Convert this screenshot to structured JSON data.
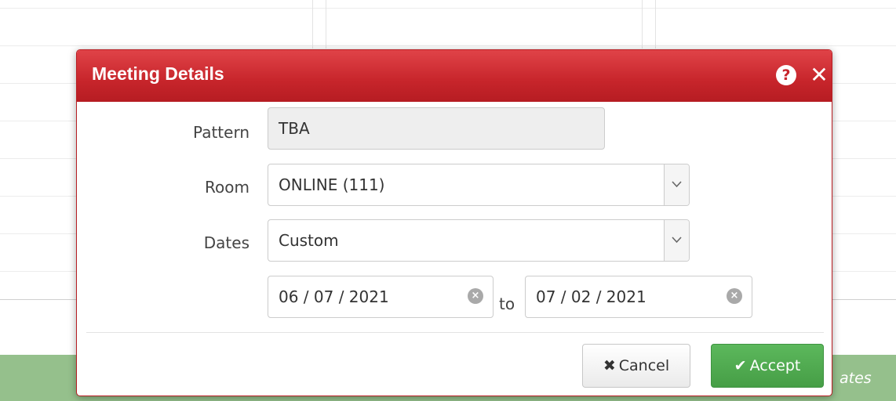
{
  "background": {
    "footer_text": "ates"
  },
  "dialog": {
    "title": "Meeting Details",
    "help_glyph": "?",
    "close_glyph": "✕",
    "fields": {
      "pattern": {
        "label": "Pattern",
        "value": "TBA"
      },
      "room": {
        "label": "Room",
        "value": "ONLINE (111)"
      },
      "dates": {
        "label": "Dates",
        "value": "Custom"
      },
      "start_date": {
        "value": "06 / 07 / 2021"
      },
      "to_label": "to",
      "end_date": {
        "value": "07 / 02 / 2021"
      }
    },
    "buttons": {
      "cancel": {
        "icon": "✖",
        "label": "Cancel"
      },
      "accept": {
        "icon": "✔",
        "label": "Accept"
      }
    }
  },
  "colors": {
    "header_red": "#c7252b",
    "accept_green": "#5cb85c",
    "bg_green": "#95c08c"
  },
  "icons": {
    "help": "help-circle-icon",
    "close": "close-icon",
    "dropdown": "chevron-down-icon",
    "clear": "clear-circle-icon",
    "cancel": "times-icon",
    "accept": "check-icon"
  }
}
